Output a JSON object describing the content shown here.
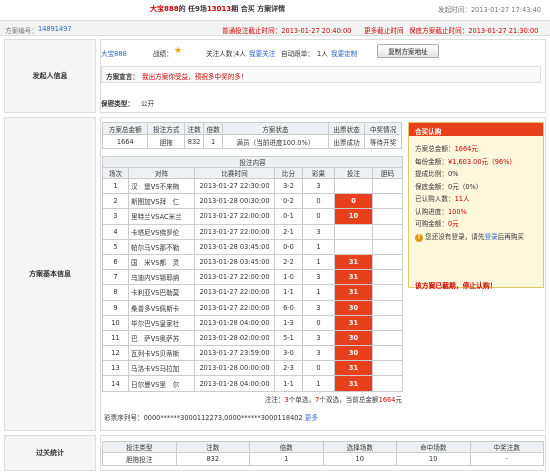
{
  "header": {
    "title_user": "大宝888",
    "title_mid": "的 任9场",
    "title_issue": "13013",
    "title_end": "期 合买 方案详情",
    "time_label": "发起时间：",
    "time": "2013-01-27 17:43:40"
  },
  "sub": {
    "plan_no_label": "方案编号：",
    "plan_no": "14891497",
    "normal_deadline": "普通投注截止时间：2013-01-27 20:40:00",
    "more_deadline": "更多截止时间",
    "baodi_deadline": "保底方案截止时间：2013-01-27 21:30:00"
  },
  "sponsor": {
    "section": "发起人信息",
    "user": "大宝888",
    "zhanji_label": "战绩：",
    "follow_label": "关注人数：",
    "follow_count": "4人",
    "follow_link": "我要关注",
    "auto_label": "自动跟单：",
    "auto_count": "1人",
    "auto_link": "我要定制",
    "copy_btn": "复制方案地址",
    "declare_label": "方案宣言：",
    "declare_text": "我出方案你受益，预祝多中奖的多！",
    "secrecy_label": "保密类型：",
    "secrecy_value": "公开"
  },
  "basic": {
    "section": "方案基本信息",
    "summary_headers": [
      "方案总金额",
      "投注方式",
      "注数",
      "倍数",
      "方案状态",
      "出票状态",
      "中奖情况"
    ],
    "summary_values": [
      "1664",
      "胆拖",
      "832",
      "1",
      "满员（当前进度100.0%）",
      "出票成功",
      "等待开奖"
    ],
    "detail_title": "投注内容",
    "detail_headers": [
      "场次",
      "对阵",
      "比赛时间",
      "比分",
      "彩果",
      "投注",
      "胆码"
    ],
    "matches": [
      {
        "no": "1",
        "vs": "汉　堡VS不来梅",
        "time": "2013-01-27 22:30:00",
        "score": "3-2",
        "res": "3",
        "bet": "",
        "hit": false,
        "dan": ""
      },
      {
        "no": "2",
        "vs": "斯图加VS拜　仁",
        "time": "2013-01-28 00:30:00",
        "score": "0-2",
        "res": "0",
        "bet": "0",
        "hit": true,
        "dan": ""
      },
      {
        "no": "3",
        "vs": "里特兰VSAC米兰",
        "time": "2013-01-27 22:00:00",
        "score": "0-1",
        "res": "0",
        "bet": "10",
        "hit": true,
        "dan": ""
      },
      {
        "no": "4",
        "vs": "卡塔尼VS佛罗伦",
        "time": "2013-01-27 22:00:00",
        "score": "2-1",
        "res": "3",
        "bet": "",
        "hit": false,
        "dan": ""
      },
      {
        "no": "5",
        "vs": "帕尔马VS那不勒",
        "time": "2013-01-28 03:45:00",
        "score": "0-0",
        "res": "1",
        "bet": "",
        "hit": false,
        "dan": ""
      },
      {
        "no": "6",
        "vs": "国　米VS都　灵",
        "time": "2013-01-28 03:45:00",
        "score": "2-2",
        "res": "1",
        "bet": "31",
        "hit": true,
        "dan": ""
      },
      {
        "no": "7",
        "vs": "乌迪内VS锡耶纳",
        "time": "2013-01-27 22:00:00",
        "score": "1-0",
        "res": "3",
        "bet": "31",
        "hit": true,
        "dan": ""
      },
      {
        "no": "8",
        "vs": "卡利亚VS巴勒莫",
        "time": "2013-01-27 22:00:00",
        "score": "1-1",
        "res": "1",
        "bet": "31",
        "hit": true,
        "dan": ""
      },
      {
        "no": "9",
        "vs": "桑普多VS佩斯卡",
        "time": "2013-01-27 22:00:00",
        "score": "6-0",
        "res": "3",
        "bet": "30",
        "hit": true,
        "dan": ""
      },
      {
        "no": "10",
        "vs": "毕尔巴VS皇家社",
        "time": "2013-01-28 04:00:00",
        "score": "1-3",
        "res": "0",
        "bet": "31",
        "hit": true,
        "dan": ""
      },
      {
        "no": "11",
        "vs": "巴　萨VS奥萨苏",
        "time": "2013-01-28 02:00:00",
        "score": "5-1",
        "res": "3",
        "bet": "30",
        "hit": true,
        "dan": ""
      },
      {
        "no": "12",
        "vs": "瓦列卡VS贝蒂斯",
        "time": "2013-01-27 23:59:00",
        "score": "3-0",
        "res": "3",
        "bet": "30",
        "hit": true,
        "dan": ""
      },
      {
        "no": "13",
        "vs": "马洛卡VS马拉加",
        "time": "2013-01-28 00:00:00",
        "score": "2-3",
        "res": "0",
        "bet": "31",
        "hit": true,
        "dan": ""
      },
      {
        "no": "14",
        "vs": "日尔曼VS里　尔",
        "time": "2013-01-28 04:00:00",
        "score": "1-1",
        "res": "1",
        "bet": "31",
        "hit": true,
        "dan": ""
      }
    ],
    "footer_a": "注注：",
    "footer_count": "3",
    "footer_b": "个单选，",
    "footer_c": "7",
    "footer_d": "个双选，当前总金额",
    "footer_amount": "1664",
    "footer_e": "元",
    "serial_label": "彩票序列号：",
    "serial": "0000******3000112273,0000******3000118402",
    "serial_more": "更多"
  },
  "sub_panel": {
    "title": "合买认购",
    "total_label": "方案总金额：",
    "total": "1664元",
    "share_label": "每份金额：",
    "share": "¥1,603.00元（96%）",
    "bonus_label": "提成比例：",
    "bonus": "0%",
    "baodi_label": "保底金额：",
    "baodi": "0元（0%）",
    "buyers_label": "已认购人数：",
    "buyers": "11人",
    "progress_label": "认购进度：",
    "progress": "100%",
    "money_label": "可购金额：",
    "money": "0元",
    "login_a": "您还没有登录，请先",
    "login_link": "登录",
    "login_b": "后再购买",
    "full_notice": "该方案已截期，停止认购！"
  },
  "pass": {
    "section": "过关统计",
    "headers": [
      "投注类型",
      "注数",
      "倍数",
      "选择场数",
      "命中场数",
      "中奖注数"
    ],
    "values": [
      "胆拖投注",
      "832",
      "1",
      "10",
      "10",
      "-"
    ]
  },
  "colors": {
    "accent_red": "#e8401c",
    "title_red": "#c00",
    "panel_bg": "#fdf8dc"
  }
}
